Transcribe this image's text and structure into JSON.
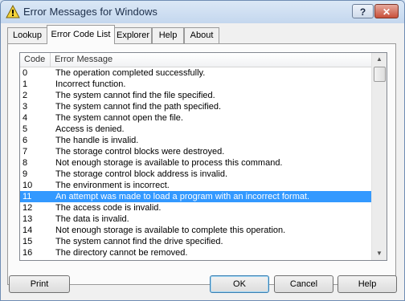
{
  "window": {
    "title": "Error Messages for Windows",
    "help_glyph": "?",
    "close_glyph": "✕"
  },
  "tabs": [
    {
      "label": "Lookup"
    },
    {
      "label": "Error Code List",
      "active": true
    },
    {
      "label": "Explorer"
    },
    {
      "label": "Help"
    },
    {
      "label": "About"
    }
  ],
  "list": {
    "columns": [
      "Code",
      "Error Message"
    ],
    "selected_code": "11",
    "rows": [
      {
        "code": "0",
        "message": "The operation completed successfully."
      },
      {
        "code": "1",
        "message": "Incorrect function."
      },
      {
        "code": "2",
        "message": "The system cannot find the file specified."
      },
      {
        "code": "3",
        "message": "The system cannot find the path specified."
      },
      {
        "code": "4",
        "message": "The system cannot open the file."
      },
      {
        "code": "5",
        "message": "Access is denied."
      },
      {
        "code": "6",
        "message": "The handle is invalid."
      },
      {
        "code": "7",
        "message": "The storage control blocks were destroyed."
      },
      {
        "code": "8",
        "message": "Not enough storage is available to process this command."
      },
      {
        "code": "9",
        "message": "The storage control block address is invalid."
      },
      {
        "code": "10",
        "message": "The environment is incorrect."
      },
      {
        "code": "11",
        "message": "An attempt was made to load a program with an incorrect format."
      },
      {
        "code": "12",
        "message": "The access code is invalid."
      },
      {
        "code": "13",
        "message": "The data is invalid."
      },
      {
        "code": "14",
        "message": "Not enough storage is available to complete this operation."
      },
      {
        "code": "15",
        "message": "The system cannot find the drive specified."
      },
      {
        "code": "16",
        "message": "The directory cannot be removed."
      }
    ]
  },
  "buttons": {
    "print": "Print",
    "ok": "OK",
    "cancel": "Cancel",
    "help": "Help"
  },
  "colors": {
    "selection": "#3399ff",
    "title_bar": "#c4d7ee",
    "close_button": "#c8503a"
  },
  "icons": {
    "app": "warning-icon",
    "scroll_up": "chevron-up-icon",
    "scroll_down": "chevron-down-icon"
  }
}
